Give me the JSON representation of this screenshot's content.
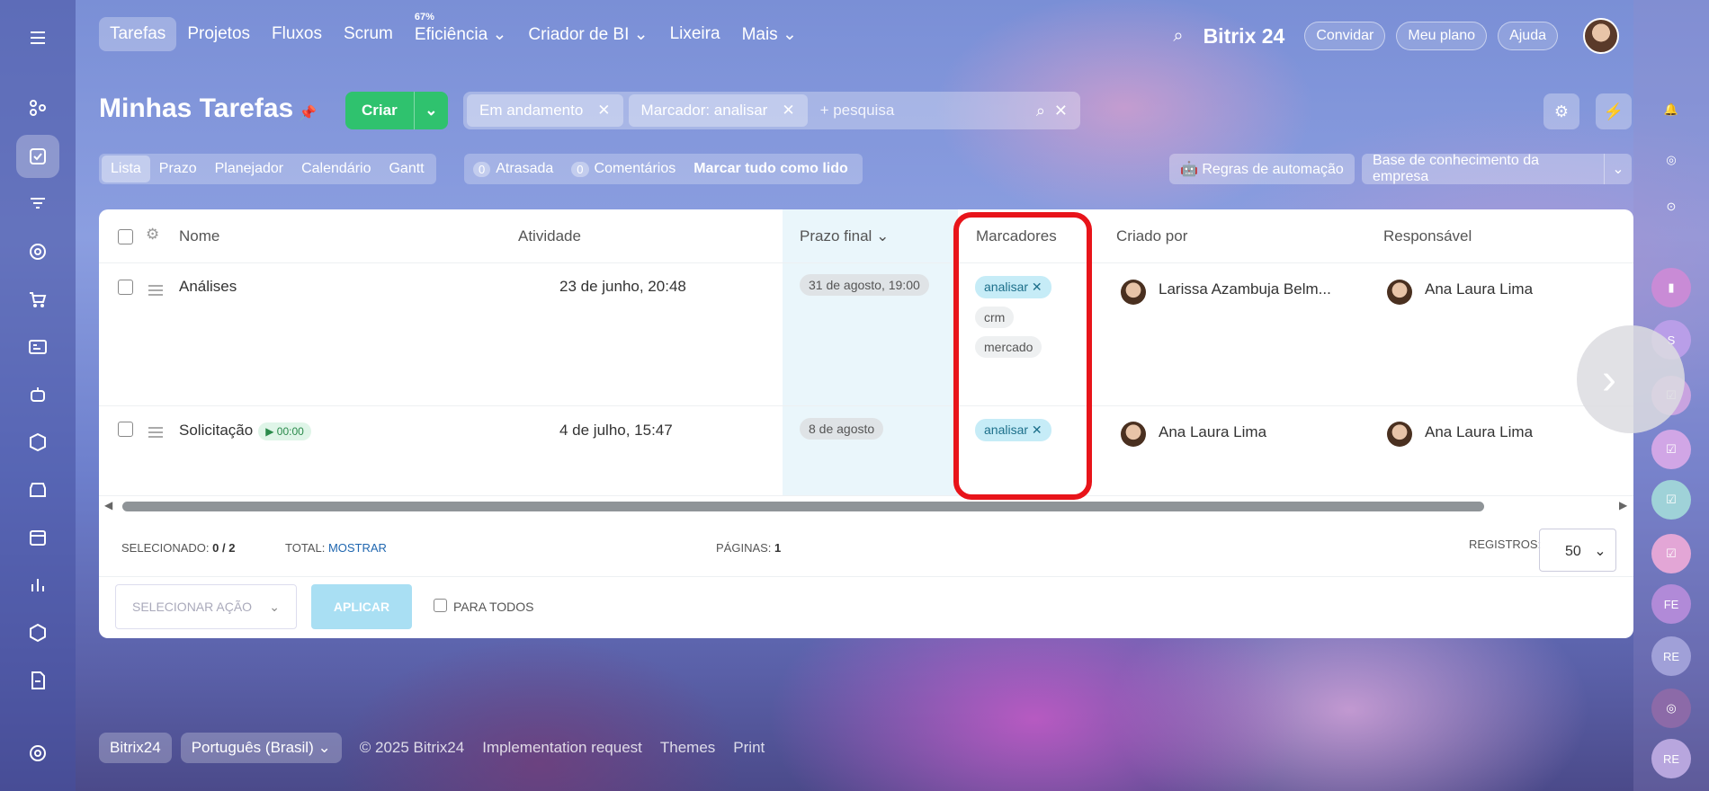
{
  "topnav": {
    "items": [
      "Tarefas",
      "Projetos",
      "Fluxos",
      "Scrum",
      "Eficiência",
      "Criador de BI",
      "Lixeira",
      "Mais"
    ],
    "efficiency_pct": "67%"
  },
  "topright": {
    "brand": "Bitrix 24",
    "invite": "Convidar",
    "plan": "Meu plano",
    "help": "Ajuda"
  },
  "page": {
    "title": "Minhas Tarefas",
    "create": "Criar"
  },
  "filter": {
    "chips": [
      "Em andamento",
      "Marcador: analisar"
    ],
    "placeholder": "+ pesquisa"
  },
  "views": [
    "Lista",
    "Prazo",
    "Planejador",
    "Calendário",
    "Gantt"
  ],
  "counters": {
    "overdue_n": "0",
    "overdue": "Atrasada",
    "comments_n": "0",
    "comments": "Comentários",
    "mark_all": "Marcar tudo como lido"
  },
  "automation": "Regras de automação",
  "knowledge": "Base de conhecimento da empresa",
  "table": {
    "headers": {
      "name": "Nome",
      "activity": "Atividade",
      "deadline": "Prazo final",
      "tags": "Marcadores",
      "creator": "Criado por",
      "responsible": "Responsável"
    },
    "rows": [
      {
        "name": "Análises",
        "activity": "23 de junho, 20:48",
        "deadline": "31 de agosto, 19:00",
        "tags": [
          "analisar",
          "crm",
          "mercado"
        ],
        "creator": "Larissa Azambuja Belm...",
        "responsible": "Ana Laura Lima"
      },
      {
        "name": "Solicitação",
        "timer": "00:00",
        "activity": "4 de julho, 15:47",
        "deadline": "8 de agosto",
        "tags": [
          "analisar"
        ],
        "creator": "Ana Laura Lima",
        "responsible": "Ana Laura Lima"
      }
    ]
  },
  "footer": {
    "selected_label": "SELECIONADO:",
    "selected": "0 / 2",
    "total_label": "TOTAL:",
    "total_link": "MOSTRAR",
    "pages_label": "PÁGINAS:",
    "pages": "1",
    "records_label": "REGISTROS:",
    "records": "50",
    "action_placeholder": "SELECIONAR AÇÃO",
    "apply": "APLICAR",
    "for_all": "PARA TODOS"
  },
  "bottom": {
    "brand": "Bitrix24",
    "lang": "Português (Brasil)",
    "copyright": "© 2025 Bitrix24",
    "impl": "Implementation request",
    "themes": "Themes",
    "print": "Print"
  },
  "rightbar": {
    "initials": [
      "S",
      "FE",
      "RE",
      "RE"
    ]
  }
}
